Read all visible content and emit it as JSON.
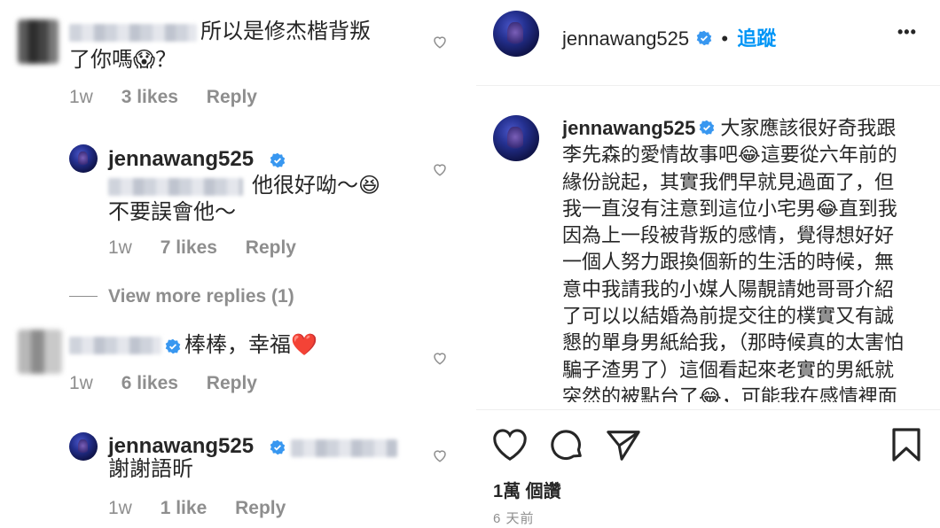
{
  "left": {
    "comment1": {
      "text_line1": "所以是修杰楷背叛",
      "text_line2": "了你嗎😱？",
      "time": "1w",
      "likes": "3 likes",
      "reply": "Reply"
    },
    "reply1": {
      "username": "jennawang525",
      "text_line1": "他很好呦～😆",
      "text_line2": "不要誤會他～",
      "time": "1w",
      "likes": "7 likes",
      "reply": "Reply"
    },
    "view_more": "View more replies (1)",
    "comment2": {
      "text": "棒棒，幸福❤️",
      "time": "1w",
      "likes": "6 likes",
      "reply": "Reply"
    },
    "reply2": {
      "username": "jennawang525",
      "text": "謝謝語昕",
      "time": "1w",
      "likes": "1 like",
      "reply": "Reply"
    }
  },
  "right": {
    "header": {
      "username": "jennawang525",
      "dot": "•",
      "follow": "追蹤",
      "more": "•••"
    },
    "caption": {
      "username": "jennawang525",
      "text": "大家應該很好奇我跟李先森的愛情故事吧😂這要從六年前的緣份說起，其實我們早就見過面了，但我一直沒有注意到這位小宅男😂直到我因為上一段被背叛的感情，覺得想好好一個人努力跟換個新的生活的時候，無意中我請我的小媒人陽靚請她哥哥介紹了可以以結婚為前提交往的樸實又有誠懇的單身男紙給我，（那時候真的太害怕騙子渣男了）這個看起來老實的男紙就突然的被點台了😂，可能我在感情裡面很在意聊不聊的來，還好這個水瓶座"
    },
    "likes": "1萬 個讚",
    "time": "6 天前"
  },
  "colors": {
    "text": "#262626",
    "secondary": "#8e8e8e",
    "follow_blue": "#0095f6",
    "verified_blue": "#3897f0",
    "heart_red": "#e0245e"
  }
}
